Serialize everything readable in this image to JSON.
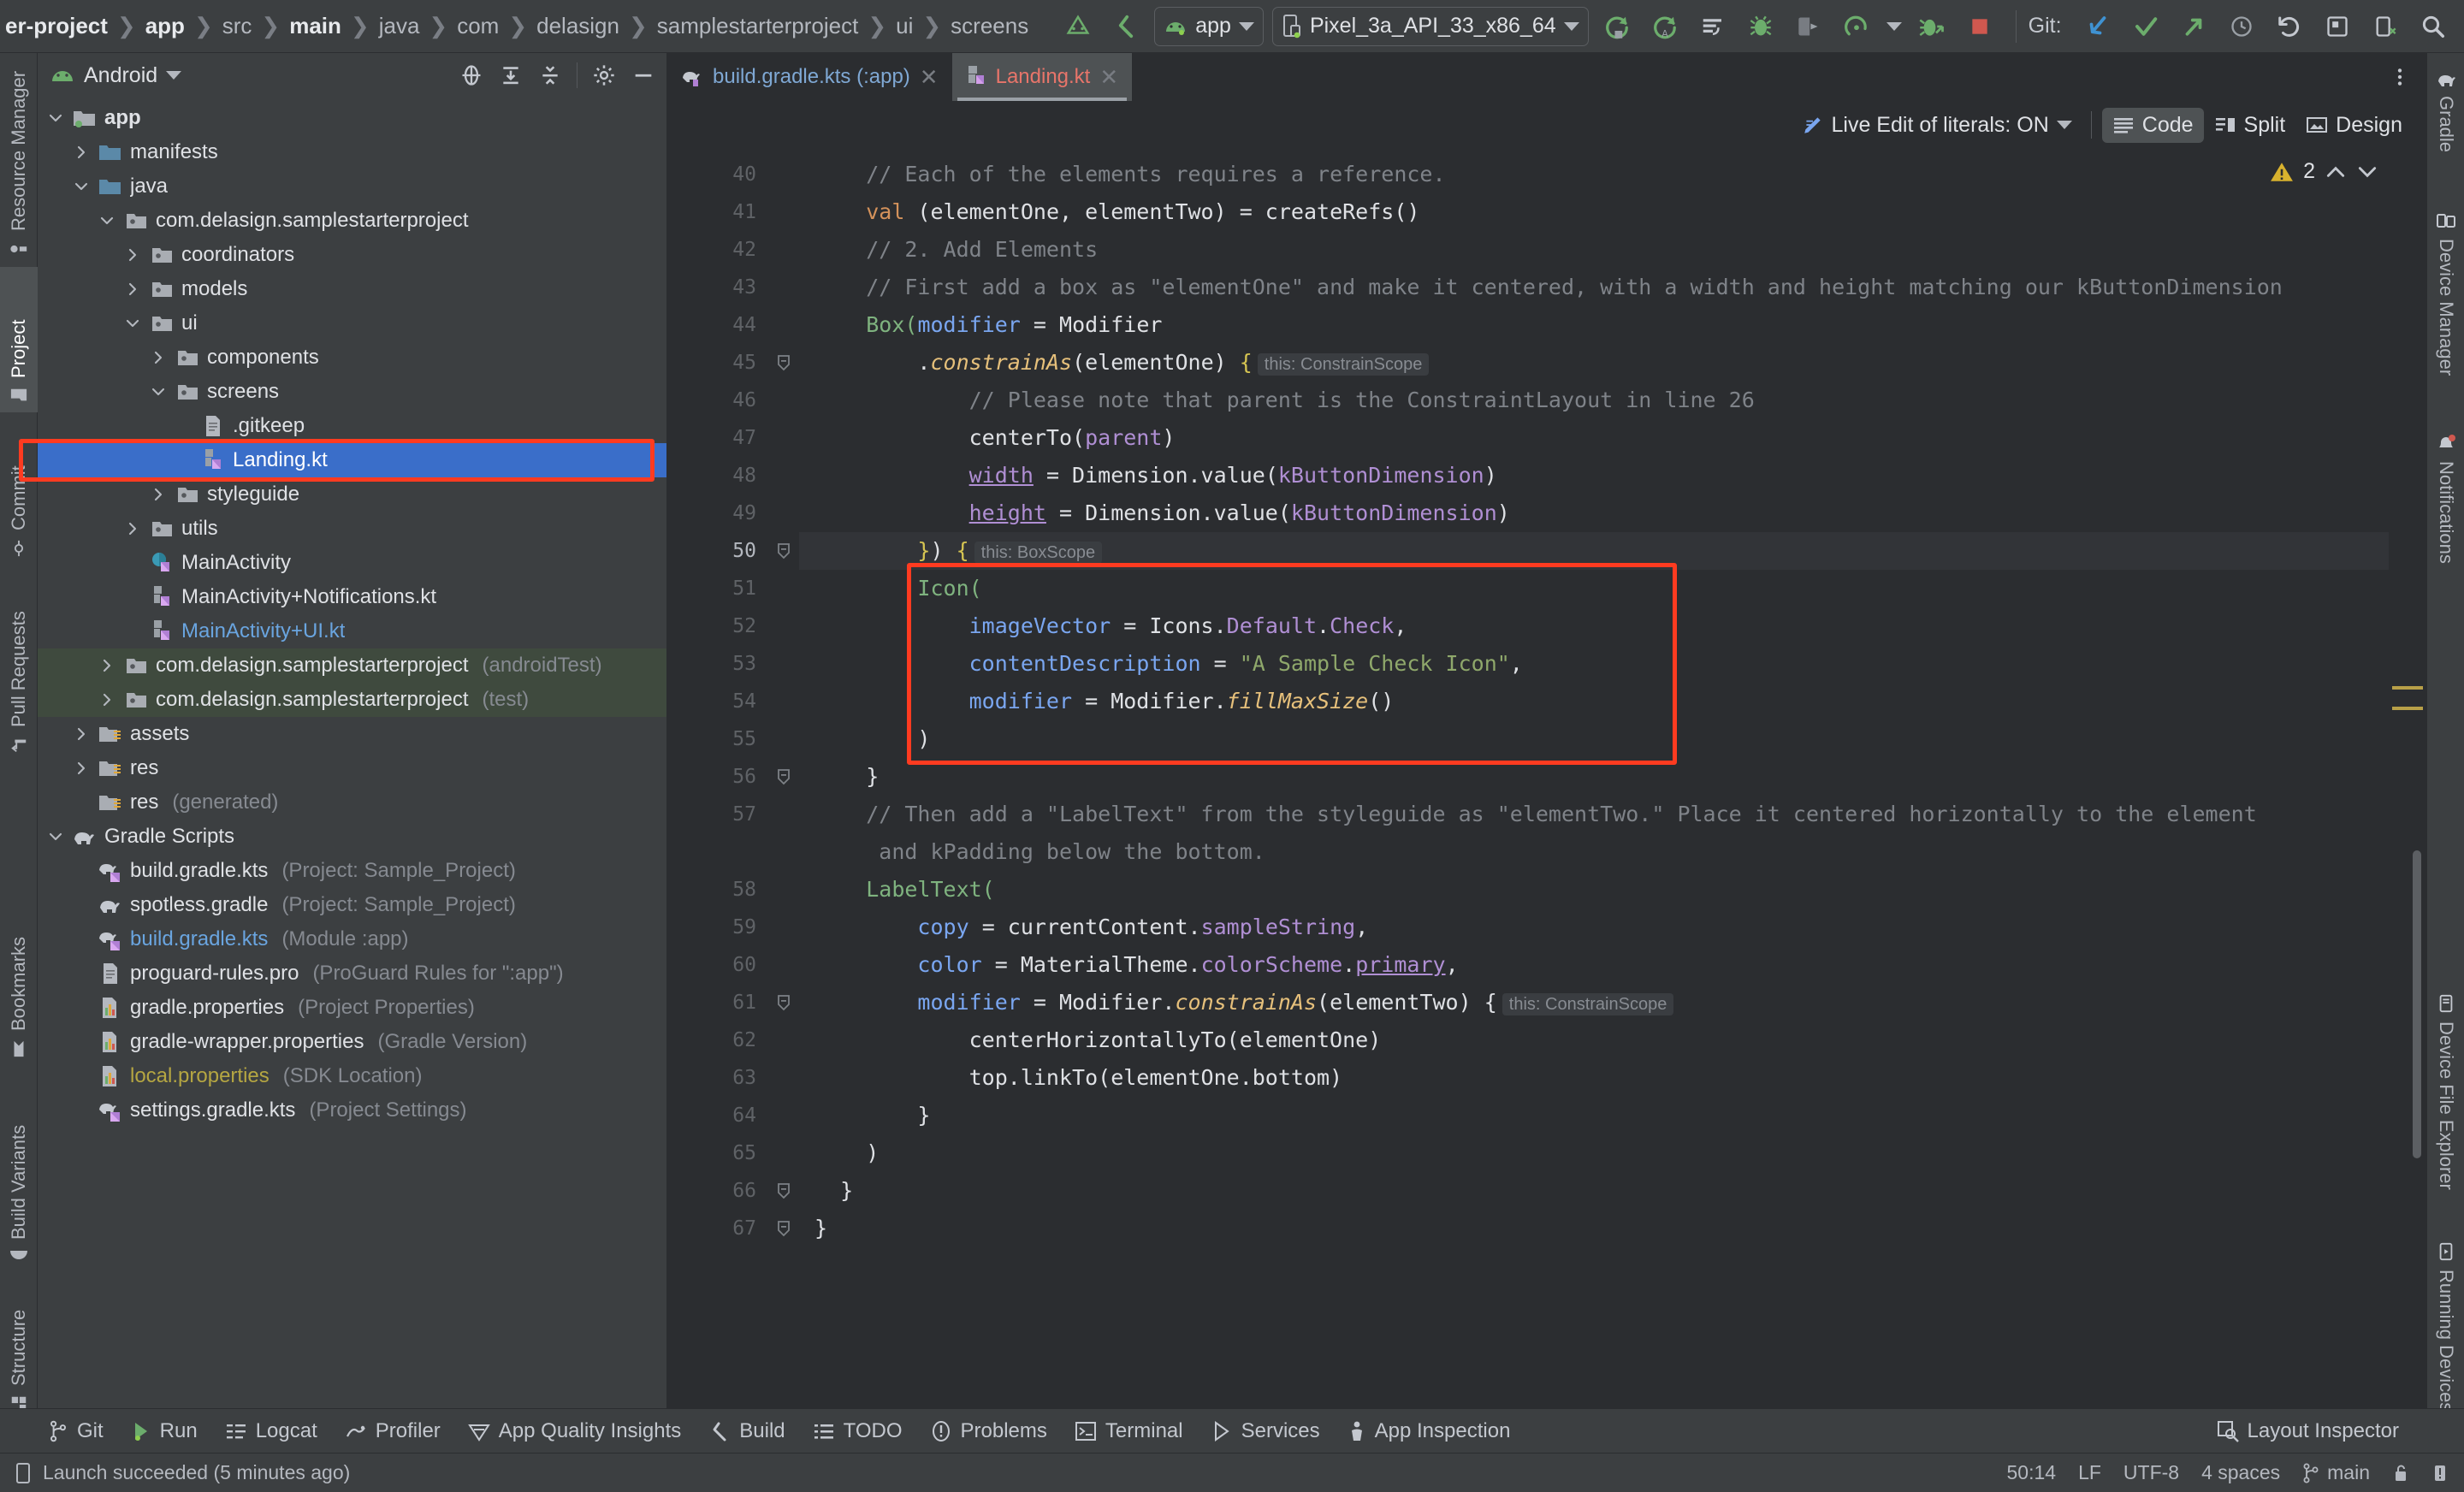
{
  "topbar": {
    "breadcrumbs": [
      {
        "label": "er-project",
        "bold": true
      },
      {
        "label": "app",
        "bold": true
      },
      {
        "label": "src",
        "bold": false
      },
      {
        "label": "main",
        "bold": true
      },
      {
        "label": "java",
        "bold": false
      },
      {
        "label": "com",
        "bold": false
      },
      {
        "label": "delasign",
        "bold": false
      },
      {
        "label": "samplestarterproject",
        "bold": false
      },
      {
        "label": "ui",
        "bold": false
      },
      {
        "label": "screens",
        "bold": false
      }
    ],
    "run_config": "app",
    "device": "Pixel_3a_API_33_x86_64",
    "git_label": "Git:",
    "icons": [
      "android-studio-icon",
      "back-arrow-icon",
      "run-icon",
      "run-with-coverage-icon",
      "apply-changes-icon",
      "debug-icon",
      "attach-debugger-icon",
      "profile-icon",
      "profile-dropdown-icon",
      "debug-attach-icon",
      "stop-icon",
      "git-update-icon",
      "git-commit-icon",
      "git-push-icon",
      "undo-icon",
      "layout-inspector-icon",
      "device-explorer-icon",
      "search-icon",
      "menu-icon"
    ]
  },
  "left_rail": {
    "top_items": [
      {
        "label": "Resource Manager",
        "icon": "resource-manager-icon",
        "selected": false
      },
      {
        "label": "Project",
        "icon": "project-folder-icon",
        "selected": true
      },
      {
        "label": "Commit",
        "icon": "commit-icon",
        "selected": false
      },
      {
        "label": "Pull Requests",
        "icon": "pull-requests-icon",
        "selected": false
      }
    ],
    "bottom_items": [
      {
        "label": "Bookmarks",
        "icon": "bookmark-icon"
      },
      {
        "label": "Build Variants",
        "icon": "android-head-icon"
      },
      {
        "label": "Structure",
        "icon": "structure-icon"
      }
    ]
  },
  "right_rail": {
    "top_items": [
      {
        "label": "Gradle",
        "icon": "gradle-elephant-icon"
      },
      {
        "label": "Device Manager",
        "icon": "device-manager-icon"
      },
      {
        "label": "Notifications",
        "icon": "notifications-bell-icon"
      }
    ],
    "bottom_items": [
      {
        "label": "Device File Explorer",
        "icon": "device-file-explorer-icon"
      },
      {
        "label": "Running Devices",
        "icon": "running-devices-icon"
      }
    ]
  },
  "project_panel": {
    "title": "Android",
    "header_icons": [
      "select-opened-file-icon",
      "expand-all-icon",
      "collapse-all-icon",
      "settings-gear-icon",
      "hide-minimize-icon"
    ],
    "tree": [
      {
        "indent": 0,
        "arrow": "down",
        "icon": "module-folder-icon",
        "label": "app",
        "bold": true
      },
      {
        "indent": 1,
        "arrow": "right",
        "icon": "blue-folder-icon",
        "label": "manifests"
      },
      {
        "indent": 1,
        "arrow": "down",
        "icon": "blue-folder-icon",
        "label": "java"
      },
      {
        "indent": 2,
        "arrow": "down",
        "icon": "package-icon",
        "label": "com.delasign.samplestarterproject"
      },
      {
        "indent": 3,
        "arrow": "right",
        "icon": "package-icon",
        "label": "coordinators"
      },
      {
        "indent": 3,
        "arrow": "right",
        "icon": "package-icon",
        "label": "models"
      },
      {
        "indent": 3,
        "arrow": "down",
        "icon": "package-icon",
        "label": "ui"
      },
      {
        "indent": 4,
        "arrow": "right",
        "icon": "package-icon",
        "label": "components"
      },
      {
        "indent": 4,
        "arrow": "down",
        "icon": "package-icon",
        "label": "screens"
      },
      {
        "indent": 5,
        "arrow": "none",
        "icon": "file-icon",
        "label": ".gitkeep"
      },
      {
        "indent": 5,
        "arrow": "none",
        "icon": "kotlin-file-icon",
        "label": "Landing.kt",
        "selected": true
      },
      {
        "indent": 4,
        "arrow": "right",
        "icon": "package-icon",
        "label": "styleguide"
      },
      {
        "indent": 3,
        "arrow": "right",
        "icon": "package-icon",
        "label": "utils"
      },
      {
        "indent": 3,
        "arrow": "none",
        "icon": "kotlin-class-icon",
        "label": "MainActivity"
      },
      {
        "indent": 3,
        "arrow": "none",
        "icon": "kotlin-file-icon",
        "label": "MainActivity+Notifications.kt"
      },
      {
        "indent": 3,
        "arrow": "none",
        "icon": "kotlin-file-icon",
        "label": "MainActivity+UI.kt",
        "color": "blue"
      },
      {
        "indent": 2,
        "arrow": "right",
        "icon": "package-icon",
        "label": "com.delasign.samplestarterproject",
        "sub": "(androidTest)",
        "testsrc": true
      },
      {
        "indent": 2,
        "arrow": "right",
        "icon": "package-icon",
        "label": "com.delasign.samplestarterproject",
        "sub": "(test)",
        "testsrc": true
      },
      {
        "indent": 1,
        "arrow": "right",
        "icon": "res-folder-icon",
        "label": "assets"
      },
      {
        "indent": 1,
        "arrow": "right",
        "icon": "res-folder-icon",
        "label": "res"
      },
      {
        "indent": 1,
        "arrow": "none",
        "icon": "res-folder-icon",
        "label": "res",
        "sub": "(generated)"
      },
      {
        "indent": 0,
        "arrow": "down",
        "icon": "gradle-elephant-icon",
        "label": "Gradle Scripts"
      },
      {
        "indent": 1,
        "arrow": "none",
        "icon": "gradle-kts-icon",
        "label": "build.gradle.kts",
        "sub": "(Project: Sample_Project)"
      },
      {
        "indent": 1,
        "arrow": "none",
        "icon": "gradle-elephant-icon",
        "label": "spotless.gradle",
        "sub": "(Project: Sample_Project)"
      },
      {
        "indent": 1,
        "arrow": "none",
        "icon": "gradle-kts-icon",
        "label": "build.gradle.kts",
        "sub": "(Module :app)",
        "color": "blue"
      },
      {
        "indent": 1,
        "arrow": "none",
        "icon": "file-icon",
        "label": "proguard-rules.pro",
        "sub": "(ProGuard Rules for \":app\")"
      },
      {
        "indent": 1,
        "arrow": "none",
        "icon": "properties-icon",
        "label": "gradle.properties",
        "sub": "(Project Properties)"
      },
      {
        "indent": 1,
        "arrow": "none",
        "icon": "properties-icon",
        "label": "gradle-wrapper.properties",
        "sub": "(Gradle Version)"
      },
      {
        "indent": 1,
        "arrow": "none",
        "icon": "properties-icon",
        "label": "local.properties",
        "sub": "(SDK Location)",
        "color": "yellow"
      },
      {
        "indent": 1,
        "arrow": "none",
        "icon": "gradle-kts-icon",
        "label": "settings.gradle.kts",
        "sub": "(Project Settings)"
      }
    ]
  },
  "editor": {
    "tabs": [
      {
        "label": "build.gradle.kts (:app)",
        "icon": "gradle-kts-icon",
        "active": false
      },
      {
        "label": "Landing.kt",
        "icon": "kotlin-file-icon",
        "active": true
      }
    ],
    "live_edit": "Live Edit of literals: ON",
    "modes": [
      {
        "label": "Code",
        "icon": "code-view-icon",
        "selected": true
      },
      {
        "label": "Split",
        "icon": "split-view-icon",
        "selected": false
      },
      {
        "label": "Design",
        "icon": "design-view-icon",
        "selected": false
      }
    ],
    "warning_count": "2",
    "first_line_number": 40,
    "lines": [
      {
        "n": 40,
        "indent": 4,
        "tokens": [
          {
            "t": "// Each of the elements requires a reference.",
            "c": "cm"
          }
        ]
      },
      {
        "n": 41,
        "indent": 4,
        "tokens": [
          {
            "t": "val",
            "c": "kw"
          },
          {
            "t": " (elementOne, elementTwo) = createRefs()",
            "c": "pl"
          }
        ]
      },
      {
        "n": 42,
        "indent": 4,
        "tokens": [
          {
            "t": "// 2. Add Elements",
            "c": "cm"
          }
        ]
      },
      {
        "n": 43,
        "indent": 4,
        "tokens": [
          {
            "t": "// First add a box as \"elementOne\" and make it centered, with a width and height matching our kButtonDimension",
            "c": "cm"
          }
        ]
      },
      {
        "n": 44,
        "indent": 4,
        "tokens": [
          {
            "t": "Box(",
            "c": "fn"
          },
          {
            "t": "modifier",
            "c": "par"
          },
          {
            "t": " = Modifier",
            "c": "pl"
          }
        ]
      },
      {
        "n": 45,
        "indent": 8,
        "fold": true,
        "tokens": [
          {
            "t": ".",
            "c": "pl"
          },
          {
            "t": "constrainAs",
            "c": "ext"
          },
          {
            "t": "(elementOne) ",
            "c": "pl"
          },
          {
            "t": "{",
            "c": "brc"
          }
        ],
        "hint": "this: ConstrainScope"
      },
      {
        "n": 46,
        "indent": 12,
        "tokens": [
          {
            "t": "// Please note that parent is the ConstraintLayout in line 26",
            "c": "cm"
          }
        ]
      },
      {
        "n": 47,
        "indent": 12,
        "tokens": [
          {
            "t": "centerTo(",
            "c": "pl"
          },
          {
            "t": "parent",
            "c": "prp"
          },
          {
            "t": ")",
            "c": "pl"
          }
        ]
      },
      {
        "n": 48,
        "indent": 12,
        "tokens": [
          {
            "t": "width",
            "c": "prpu"
          },
          {
            "t": " = Dimension.value(",
            "c": "pl"
          },
          {
            "t": "kButtonDimension",
            "c": "prp"
          },
          {
            "t": ")",
            "c": "pl"
          }
        ]
      },
      {
        "n": 49,
        "indent": 12,
        "tokens": [
          {
            "t": "height",
            "c": "prpu"
          },
          {
            "t": " = Dimension.value(",
            "c": "pl"
          },
          {
            "t": "kButtonDimension",
            "c": "prp"
          },
          {
            "t": ")",
            "c": "pl"
          }
        ]
      },
      {
        "n": 50,
        "indent": 8,
        "fold": true,
        "current": true,
        "tokens": [
          {
            "t": "}",
            "c": "brc"
          },
          {
            "t": ") ",
            "c": "pl"
          },
          {
            "t": "{",
            "c": "brc"
          }
        ],
        "hint": "this: BoxScope"
      },
      {
        "n": 51,
        "indent": 8,
        "tokens": [
          {
            "t": "Icon(",
            "c": "fn"
          }
        ]
      },
      {
        "n": 52,
        "indent": 12,
        "tokens": [
          {
            "t": "imageVector",
            "c": "par"
          },
          {
            "t": " = Icons.",
            "c": "pl"
          },
          {
            "t": "Default",
            "c": "prp"
          },
          {
            "t": ".",
            "c": "pl"
          },
          {
            "t": "Check",
            "c": "prp"
          },
          {
            "t": ",",
            "c": "pl"
          }
        ]
      },
      {
        "n": 53,
        "indent": 12,
        "tokens": [
          {
            "t": "contentDescription",
            "c": "par"
          },
          {
            "t": " = ",
            "c": "pl"
          },
          {
            "t": "\"A Sample Check Icon\"",
            "c": "str"
          },
          {
            "t": ",",
            "c": "pl"
          }
        ]
      },
      {
        "n": 54,
        "indent": 12,
        "tokens": [
          {
            "t": "modifier",
            "c": "par"
          },
          {
            "t": " = Modifier.",
            "c": "pl"
          },
          {
            "t": "fillMaxSize",
            "c": "ext"
          },
          {
            "t": "()",
            "c": "pl"
          }
        ]
      },
      {
        "n": 55,
        "indent": 8,
        "tokens": [
          {
            "t": ")",
            "c": "pl"
          }
        ]
      },
      {
        "n": 56,
        "indent": 4,
        "fold": true,
        "tokens": [
          {
            "t": "}",
            "c": "pl"
          }
        ]
      },
      {
        "n": 57,
        "indent": 4,
        "tokens": [
          {
            "t": "// Then add a \"LabelText\" from the styleguide as \"elementTwo.\" Place it centered horizontally to the element",
            "c": "cm"
          }
        ]
      },
      {
        "n": null,
        "indent": 4,
        "tokens": [
          {
            "t": " and kPadding below the bottom.",
            "c": "cm"
          }
        ]
      },
      {
        "n": 58,
        "indent": 4,
        "tokens": [
          {
            "t": "LabelText(",
            "c": "fn"
          }
        ]
      },
      {
        "n": 59,
        "indent": 8,
        "tokens": [
          {
            "t": "copy",
            "c": "par"
          },
          {
            "t": " = currentContent.",
            "c": "pl"
          },
          {
            "t": "sampleString",
            "c": "prp"
          },
          {
            "t": ",",
            "c": "pl"
          }
        ]
      },
      {
        "n": 60,
        "indent": 8,
        "tokens": [
          {
            "t": "color",
            "c": "par"
          },
          {
            "t": " = MaterialTheme.",
            "c": "pl"
          },
          {
            "t": "colorScheme",
            "c": "prp"
          },
          {
            "t": ".",
            "c": "pl"
          },
          {
            "t": "primary",
            "c": "prpu"
          },
          {
            "t": ",",
            "c": "pl"
          }
        ]
      },
      {
        "n": 61,
        "indent": 8,
        "fold": true,
        "tokens": [
          {
            "t": "modifier",
            "c": "par"
          },
          {
            "t": " = Modifier.",
            "c": "pl"
          },
          {
            "t": "constrainAs",
            "c": "ext"
          },
          {
            "t": "(elementTwo) ",
            "c": "pl"
          },
          {
            "t": "{",
            "c": "pl"
          }
        ],
        "hint": "this: ConstrainScope"
      },
      {
        "n": 62,
        "indent": 12,
        "tokens": [
          {
            "t": "centerHorizontallyTo(elementOne)",
            "c": "pl"
          }
        ]
      },
      {
        "n": 63,
        "indent": 12,
        "tokens": [
          {
            "t": "top.linkTo(elementOne.bottom)",
            "c": "pl"
          }
        ]
      },
      {
        "n": 64,
        "indent": 8,
        "tokens": [
          {
            "t": "}",
            "c": "pl"
          }
        ]
      },
      {
        "n": 65,
        "indent": 4,
        "tokens": [
          {
            "t": ")",
            "c": "pl"
          }
        ]
      },
      {
        "n": 66,
        "indent": 2,
        "fold": true,
        "tokens": [
          {
            "t": "}",
            "c": "pl"
          }
        ]
      },
      {
        "n": 67,
        "indent": 0,
        "fold": true,
        "tokens": [
          {
            "t": "}",
            "c": "pl"
          }
        ]
      }
    ]
  },
  "tool_window_bar": {
    "left_items": [
      {
        "label": "Git",
        "icon": "git-branch-icon"
      },
      {
        "label": "Run",
        "icon": "run-play-icon"
      },
      {
        "label": "Logcat",
        "icon": "logcat-icon"
      },
      {
        "label": "Profiler",
        "icon": "profiler-icon"
      },
      {
        "label": "App Quality Insights",
        "icon": "app-quality-insights-icon"
      },
      {
        "label": "Build",
        "icon": "build-hammer-icon"
      },
      {
        "label": "TODO",
        "icon": "todo-list-icon"
      },
      {
        "label": "Problems",
        "icon": "problems-icon"
      },
      {
        "label": "Terminal",
        "icon": "terminal-icon"
      },
      {
        "label": "Services",
        "icon": "services-icon"
      },
      {
        "label": "App Inspection",
        "icon": "app-inspection-icon"
      }
    ],
    "right_items": [
      {
        "label": "Layout Inspector",
        "icon": "layout-inspector-icon"
      }
    ]
  },
  "status_bar": {
    "message": "Launch succeeded (5 minutes ago)",
    "message_icon": "device-icon",
    "caret_position": "50:14",
    "line_separator": "LF",
    "encoding": "UTF-8",
    "indent": "4 spaces",
    "branch": "main",
    "branch_icon": "git-branch-icon",
    "lock_icon": "unlocked-icon",
    "notification_icon": "notification-icon"
  },
  "annotations": {
    "file_highlight": "Landing.kt",
    "code_highlight": "Icon( block"
  },
  "colors": {
    "selection_blue": "#3a6ec9",
    "annotation_red": "#ff3b20",
    "accent_green": "#6cad6c",
    "warning_yellow": "#d8b22e"
  }
}
